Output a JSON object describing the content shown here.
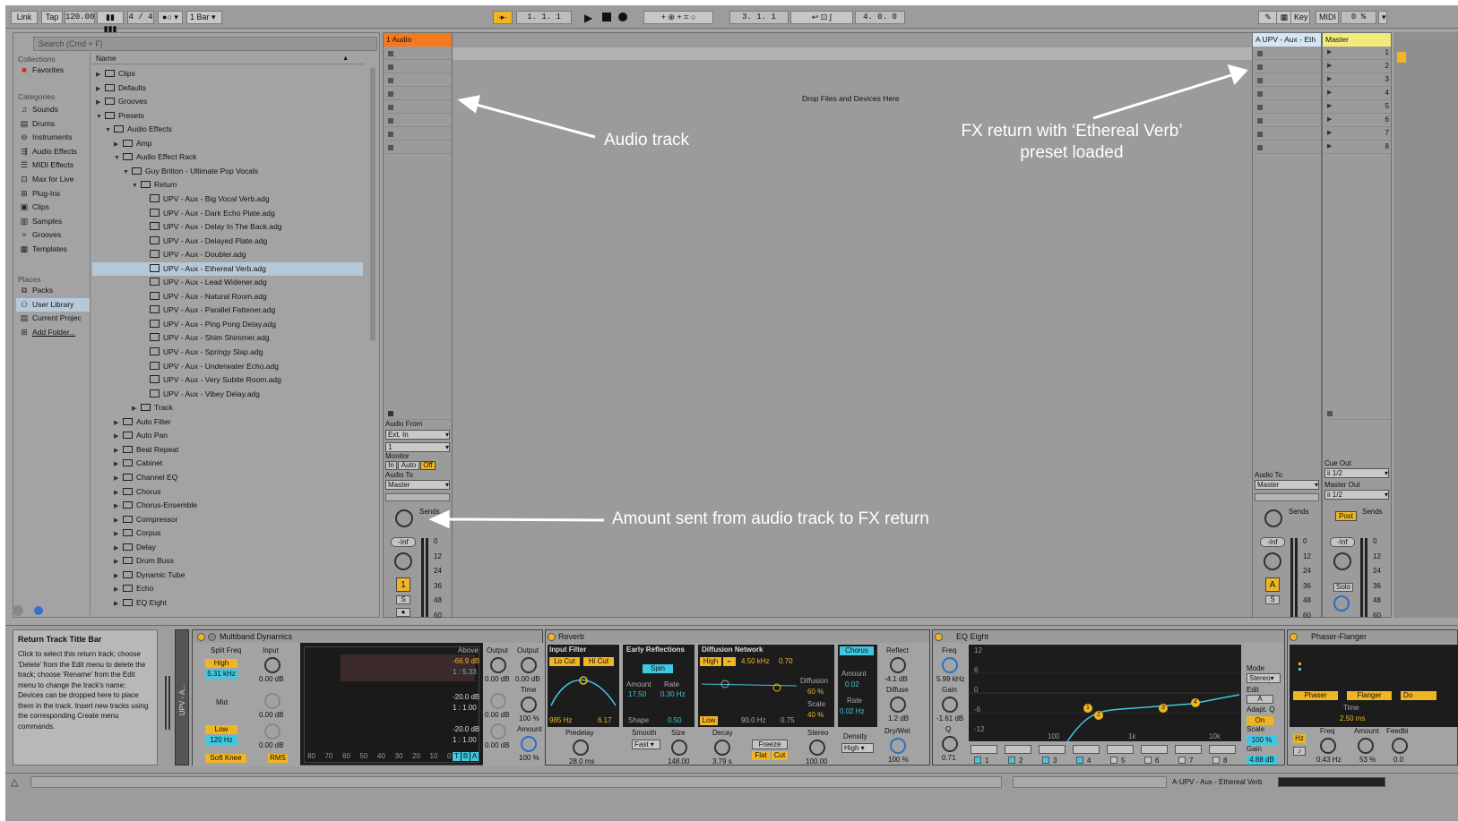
{
  "transport": {
    "link": "Link",
    "tap": "Tap",
    "tempo": "120.00",
    "sig": "4 / 4",
    "quant": "1 Bar",
    "arr_pos": "1.   1.   1",
    "loop_start": "3.   1.   1",
    "loop_len": "4.   0.   0",
    "key": "Key",
    "midi": "MIDI",
    "cpu": "0 %"
  },
  "browser": {
    "search_placeholder": "Search (Cmd + F)",
    "collections_label": "Collections",
    "favorites": "Favorites",
    "categories_label": "Categories",
    "categories": [
      "Sounds",
      "Drums",
      "Instruments",
      "Audio Effects",
      "MIDI Effects",
      "Max for Live",
      "Plug-Ins",
      "Clips",
      "Samples",
      "Grooves",
      "Templates"
    ],
    "places_label": "Places",
    "places": [
      "Packs",
      "User Library",
      "Current Projec",
      "Add Folder..."
    ],
    "name_header": "Name",
    "tree": [
      {
        "label": "Clips",
        "depth": 0,
        "type": "folder"
      },
      {
        "label": "Defaults",
        "depth": 0,
        "type": "folder"
      },
      {
        "label": "Grooves",
        "depth": 0,
        "type": "folder"
      },
      {
        "label": "Presets",
        "depth": 0,
        "type": "folder",
        "open": true
      },
      {
        "label": "Audio Effects",
        "depth": 1,
        "type": "folder",
        "open": true
      },
      {
        "label": "Amp",
        "depth": 2,
        "type": "folder"
      },
      {
        "label": "Audio Effect Rack",
        "depth": 2,
        "type": "folder",
        "open": true
      },
      {
        "label": "Guy Britton - Ultimate Pop Vocals",
        "depth": 3,
        "type": "folder",
        "open": true
      },
      {
        "label": "Return",
        "depth": 4,
        "type": "folder",
        "open": true
      },
      {
        "label": "UPV - Aux - Big Vocal Verb.adg",
        "depth": 5,
        "type": "file"
      },
      {
        "label": "UPV - Aux - Dark Echo Plate.adg",
        "depth": 5,
        "type": "file"
      },
      {
        "label": "UPV - Aux - Delay In The Back.adg",
        "depth": 5,
        "type": "file"
      },
      {
        "label": "UPV - Aux - Delayed Plate.adg",
        "depth": 5,
        "type": "file"
      },
      {
        "label": "UPV - Aux - Doubler.adg",
        "depth": 5,
        "type": "file"
      },
      {
        "label": "UPV - Aux - Ethereal Verb.adg",
        "depth": 5,
        "type": "file",
        "selected": true
      },
      {
        "label": "UPV - Aux - Lead Widener.adg",
        "depth": 5,
        "type": "file"
      },
      {
        "label": "UPV - Aux - Natural Room.adg",
        "depth": 5,
        "type": "file"
      },
      {
        "label": "UPV - Aux - Parallel Fattener.adg",
        "depth": 5,
        "type": "file"
      },
      {
        "label": "UPV - Aux - Ping Pong Delay.adg",
        "depth": 5,
        "type": "file"
      },
      {
        "label": "UPV - Aux - Shim Shimmer.adg",
        "depth": 5,
        "type": "file"
      },
      {
        "label": "UPV - Aux - Springy Slap.adg",
        "depth": 5,
        "type": "file"
      },
      {
        "label": "UPV - Aux - Underwater Echo.adg",
        "depth": 5,
        "type": "file"
      },
      {
        "label": "UPV - Aux - Very Subtle Room.adg",
        "depth": 5,
        "type": "file"
      },
      {
        "label": "UPV - Aux - Vibey Delay.adg",
        "depth": 5,
        "type": "file"
      },
      {
        "label": "Track",
        "depth": 4,
        "type": "folder"
      },
      {
        "label": "Auto Filter",
        "depth": 2,
        "type": "folder"
      },
      {
        "label": "Auto Pan",
        "depth": 2,
        "type": "folder"
      },
      {
        "label": "Beat Repeat",
        "depth": 2,
        "type": "folder"
      },
      {
        "label": "Cabinet",
        "depth": 2,
        "type": "folder"
      },
      {
        "label": "Channel EQ",
        "depth": 2,
        "type": "folder"
      },
      {
        "label": "Chorus",
        "depth": 2,
        "type": "folder"
      },
      {
        "label": "Chorus-Ensemble",
        "depth": 2,
        "type": "folder"
      },
      {
        "label": "Compressor",
        "depth": 2,
        "type": "folder"
      },
      {
        "label": "Corpus",
        "depth": 2,
        "type": "folder"
      },
      {
        "label": "Delay",
        "depth": 2,
        "type": "folder"
      },
      {
        "label": "Drum Buss",
        "depth": 2,
        "type": "folder"
      },
      {
        "label": "Dynamic Tube",
        "depth": 2,
        "type": "folder"
      },
      {
        "label": "Echo",
        "depth": 2,
        "type": "folder"
      },
      {
        "label": "EQ Eight",
        "depth": 2,
        "type": "folder"
      }
    ]
  },
  "session": {
    "audio_track": {
      "name": "1 Audio",
      "audio_from": "Audio From",
      "ext_in": "Ext. In",
      "input_ch": "1",
      "monitor": "Monitor",
      "mon_in": "In",
      "mon_auto": "Auto",
      "mon_off": "Off",
      "audio_to": "Audio To",
      "to_master": "Master",
      "sends": "Sends",
      "vol": "-Inf",
      "track_num": "1",
      "solo": "S",
      "scale": [
        "0",
        "12",
        "24",
        "36",
        "48",
        "60"
      ]
    },
    "drop_text": "Drop Files and Devices Here",
    "return_track": {
      "name": "A UPV - Aux - Eth",
      "audio_to": "Audio To",
      "to_master": "Master",
      "sends": "Sends",
      "vol": "-Inf",
      "letter": "A",
      "solo": "S",
      "scale": [
        "0",
        "12",
        "24",
        "36",
        "48",
        "60"
      ]
    },
    "master": {
      "name": "Master",
      "scenes": [
        "1",
        "2",
        "3",
        "4",
        "5",
        "6",
        "7",
        "8"
      ],
      "cue_out": "Cue Out",
      "cue_val": "ii 1/2",
      "master_out": "Master Out",
      "master_val": "ii 1/2",
      "sends": "Sends",
      "post": "Post",
      "vol": "-Inf",
      "solo": "Solo",
      "scale": [
        "0",
        "12",
        "24",
        "36",
        "48",
        "60"
      ]
    }
  },
  "annotations": {
    "audio_track": "Audio track",
    "fx_return": "FX return with ‘Ethereal Verb’",
    "fx_return2": "preset loaded",
    "amount": "Amount sent from audio track to FX return"
  },
  "info": {
    "title": "Return Track Title Bar",
    "body": "Click to select this return track; choose 'Delete' from the Edit menu to delete the track; choose 'Rename' from the Edit menu to change the track's name; Devices can be dropped here to place them in the track. Insert new tracks using the corresponding Create menu commands."
  },
  "devices": {
    "rack_label": "UPV - A...",
    "mbd": {
      "title": "Multiband Dynamics",
      "split": "Split Freq",
      "input": "Input",
      "high": "High",
      "high_freq": "5.31 kHz",
      "mid": "Mid",
      "low": "Low",
      "low_freq": "120 Hz",
      "in_db1": "0.00 dB",
      "in_db2": "0.00 dB",
      "in_db3": "0.00 dB",
      "above": "Above",
      "above_db": "-66.9 dB",
      "above_ratio": "1 : 5.33",
      "below_db": "-20.0 dB",
      "below_ratio": "1 : 1.00",
      "below_db2": "-20.0 dB",
      "below_ratio2": "1 : 1.00",
      "output": "Output",
      "out_db1": "0.00 dB",
      "out_db2": "0.00 dB",
      "out_db3": "0.00 dB",
      "output2": "Output",
      "out2_db": "0.00 dB",
      "time": "Time",
      "time_val": "100 %",
      "amount": "Amount",
      "amount_val": "100 %",
      "soft_knee": "Soft Knee",
      "rms": "RMS",
      "axis": [
        "80",
        "70",
        "60",
        "50",
        "40",
        "30",
        "20",
        "10",
        "0"
      ],
      "tba": [
        "T",
        "B",
        "A"
      ]
    },
    "reverb": {
      "title": "Reverb",
      "input_filter": "Input Filter",
      "lo_cut": "Lo Cut",
      "hi_cut": "Hi Cut",
      "freq": "985 Hz",
      "width": "6.17",
      "predelay": "Predelay",
      "predelay_val": "28.0 ms",
      "early": "Early Reflections",
      "spin": "Spin",
      "amount": "Amount",
      "amount_val": "17.50",
      "rate": "Rate",
      "rate_val": "0.30 Hz",
      "shape": "Shape",
      "shape_val": "0.50",
      "smooth": "Smooth",
      "smooth_val": "Fast",
      "size": "Size",
      "size_val": "148.00",
      "diffusion_net": "Diffusion Network",
      "high": "High",
      "hf": "4.50 kHz",
      "hv": "0.70",
      "low": "Low",
      "lf": "90.0 Hz",
      "lv": "0.75",
      "diffusion": "Diffusion",
      "diff_val": "60 %",
      "scale": "Scale",
      "scale_val": "40 %",
      "decay": "Decay",
      "decay_val": "3.79 s",
      "freeze": "Freeze",
      "flat": "Flat",
      "cut": "Cut",
      "stereo": "Stereo",
      "stereo_val": "100.00",
      "chorus": "Chorus",
      "ch_amount": "Amount",
      "ch_amount_val": "0.02",
      "ch_rate": "Rate",
      "ch_rate_val": "0.02 Hz",
      "density": "Density",
      "density_val": "High",
      "reflect": "Reflect",
      "reflect_val": "-4.1 dB",
      "diffuse": "Diffuse",
      "diffuse_val": "1.2 dB",
      "drywet": "Dry/Wet",
      "drywet_val": "100 %"
    },
    "eq": {
      "title": "EQ Eight",
      "freq": "Freq",
      "freq_val": "5.99 kHz",
      "gain": "Gain",
      "gain_val": "-1.61 dB",
      "q": "Q",
      "q_val": "0.71",
      "y_axis": [
        "12",
        "6",
        "0",
        "-6",
        "-12"
      ],
      "x_axis": [
        "100",
        "1k",
        "10k"
      ],
      "bands": [
        "1",
        "2",
        "3",
        "4",
        "5",
        "6",
        "7",
        "8"
      ],
      "mode": "Mode",
      "mode_val": "Stereo",
      "edit": "Edit",
      "edit_val": "A",
      "adapt": "Adapt. Q",
      "adapt_val": "On",
      "scale": "Scale",
      "scale_val": "100 %",
      "gain2": "Gain",
      "gain2_val": "4.88 dB"
    },
    "phaser": {
      "title": "Phaser-Flanger",
      "phaser": "Phaser",
      "flanger": "Flanger",
      "do": "Do",
      "time": "Time",
      "time_val": "2.50 ms",
      "freq": "Freq",
      "freq_val": "0.43 Hz",
      "amount": "Amount",
      "amount_val": "53 %",
      "feedback": "Feedbi",
      "feedback_val": "0.0",
      "hz": "Hz"
    }
  },
  "status": {
    "track_label": "A-UPV - Aux - Ethereal Verb"
  }
}
